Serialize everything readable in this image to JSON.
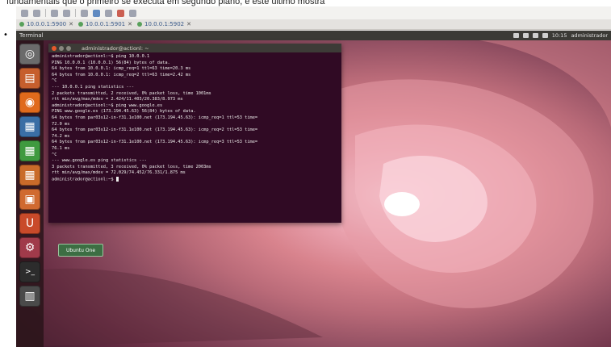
{
  "caption": "fundamentais que o primeiro se executa em segundo plano, e este último mostra",
  "bullet": "•",
  "host": {
    "tabs": [
      {
        "label": "10.0.0.1:5900"
      },
      {
        "label": "10.0.0.1:5901"
      },
      {
        "label": "10.0.0.1:5902"
      }
    ],
    "close_glyph": "✕"
  },
  "panel": {
    "title": "Terminal",
    "clock": "10:15",
    "user": "administrador"
  },
  "launcher": {
    "items": [
      {
        "name": "dash",
        "glyph": "◎",
        "color": "#6b6b6b"
      },
      {
        "name": "files",
        "glyph": "▤",
        "color": "#c65e2d"
      },
      {
        "name": "firefox",
        "glyph": "◉",
        "color": "#e06a1c"
      },
      {
        "name": "writer",
        "glyph": "▦",
        "color": "#3a6ea5"
      },
      {
        "name": "calc",
        "glyph": "▦",
        "color": "#3f9a3f"
      },
      {
        "name": "impress",
        "glyph": "▦",
        "color": "#c96b2a"
      },
      {
        "name": "software-center",
        "glyph": "▣",
        "color": "#d06a30"
      },
      {
        "name": "ubuntu-one",
        "glyph": "U",
        "color": "#c94a2a"
      },
      {
        "name": "settings",
        "glyph": "⚙",
        "color": "#a03a4a"
      },
      {
        "name": "terminal",
        "glyph": ">_",
        "color": "#2c2c2c"
      },
      {
        "name": "workspaces",
        "glyph": "▥",
        "color": "#4a4a4a"
      }
    ]
  },
  "terminal": {
    "title": "administrador@actionl: ~",
    "lines": [
      "administrador@actionl:~$ ping 10.0.0.1",
      "PING 10.0.0.1 (10.0.0.1) 56(84) bytes of data.",
      "64 bytes from 10.0.0.1: icmp_req=1 ttl=63 time=20.3 ms",
      "64 bytes from 10.0.0.1: icmp_req=2 ttl=63 time=2.42 ms",
      "^C",
      "--- 10.0.0.1 ping statistics ---",
      "2 packets transmitted, 2 received, 0% packet loss, time 1001ms",
      "rtt min/avg/max/mdev = 2.424/11.403/20.383/8.973 ms",
      "administrador@actionl:~$ ping www.google.es",
      "PING www.google.es (173.194.45.63) 56(84) bytes of data.",
      "64 bytes from par03s12-in-f31.1e100.net (173.194.45.63): icmp_req=1 ttl=53 time=",
      "72.0 ms",
      "64 bytes from par03s12-in-f31.1e100.net (173.194.45.63): icmp_req=2 ttl=53 time=",
      "74.2 ms",
      "64 bytes from par03s12-in-f31.1e100.net (173.194.45.63): icmp_req=3 ttl=53 time=",
      "76.1 ms",
      "^C",
      "--- www.google.es ping statistics ---",
      "3 packets transmitted, 3 received, 0% packet loss, time 2003ms",
      "rtt min/avg/max/mdev = 72.029/74.452/76.331/1.875 ms",
      "administrador@actionl:~$ "
    ]
  },
  "tooltip": "Ubuntu One"
}
